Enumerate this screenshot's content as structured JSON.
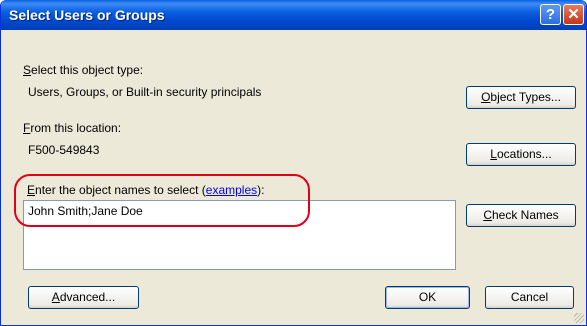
{
  "window": {
    "title": "Select Users or Groups",
    "help_glyph": "?",
    "close_glyph": "✕"
  },
  "object_type": {
    "label_accel": "S",
    "label_rest": "elect this object type:",
    "value": "Users, Groups, or Built-in security principals",
    "button_accel": "O",
    "button_rest": "bject Types..."
  },
  "location": {
    "label_accel": "F",
    "label_rest": "rom this location:",
    "value": "F500-549843",
    "button_accel": "L",
    "button_rest": "ocations..."
  },
  "names": {
    "label_accel": "E",
    "label_rest": "nter the object names to select (",
    "link": "examples",
    "label_end": "):",
    "value": "John Smith;Jane Doe",
    "check_accel": "C",
    "check_rest": "heck Names"
  },
  "footer": {
    "advanced_accel": "A",
    "advanced_rest": "dvanced...",
    "ok": "OK",
    "cancel": "Cancel"
  },
  "colors": {
    "title_blue": "#0a5fe0",
    "dialog_face": "#ece9d8",
    "highlight_red": "#e0001a",
    "link_blue": "#0000ee"
  }
}
